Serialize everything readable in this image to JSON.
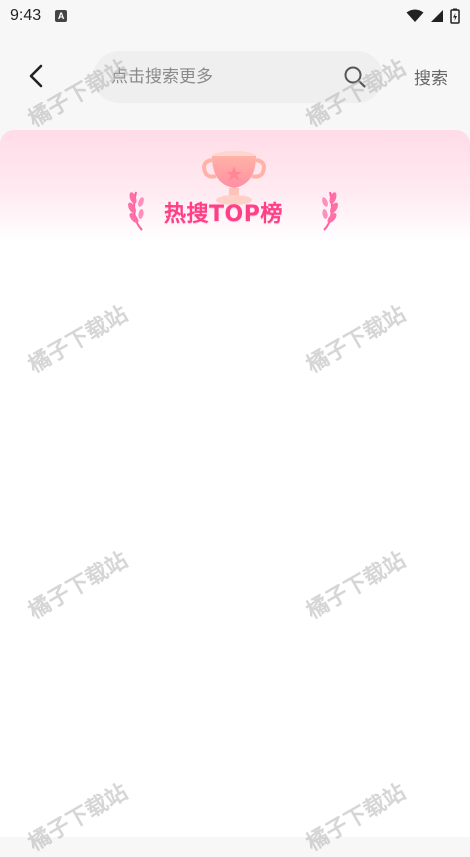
{
  "status_bar": {
    "time": "9:43",
    "badge": "A"
  },
  "search": {
    "placeholder": "点击搜索更多",
    "submit_label": "搜索"
  },
  "banner": {
    "title": "热搜TOP榜"
  },
  "watermarks": [
    "橘子下载站",
    "橘子下载站",
    "橘子下载站",
    "橘子下载站",
    "橘子下载站",
    "橘子下载站",
    "橘子下载站",
    "橘子下载站"
  ],
  "colors": {
    "accent": "#ff3f86",
    "banner_top": "#ffdce7",
    "background": "#f7f7f7"
  }
}
